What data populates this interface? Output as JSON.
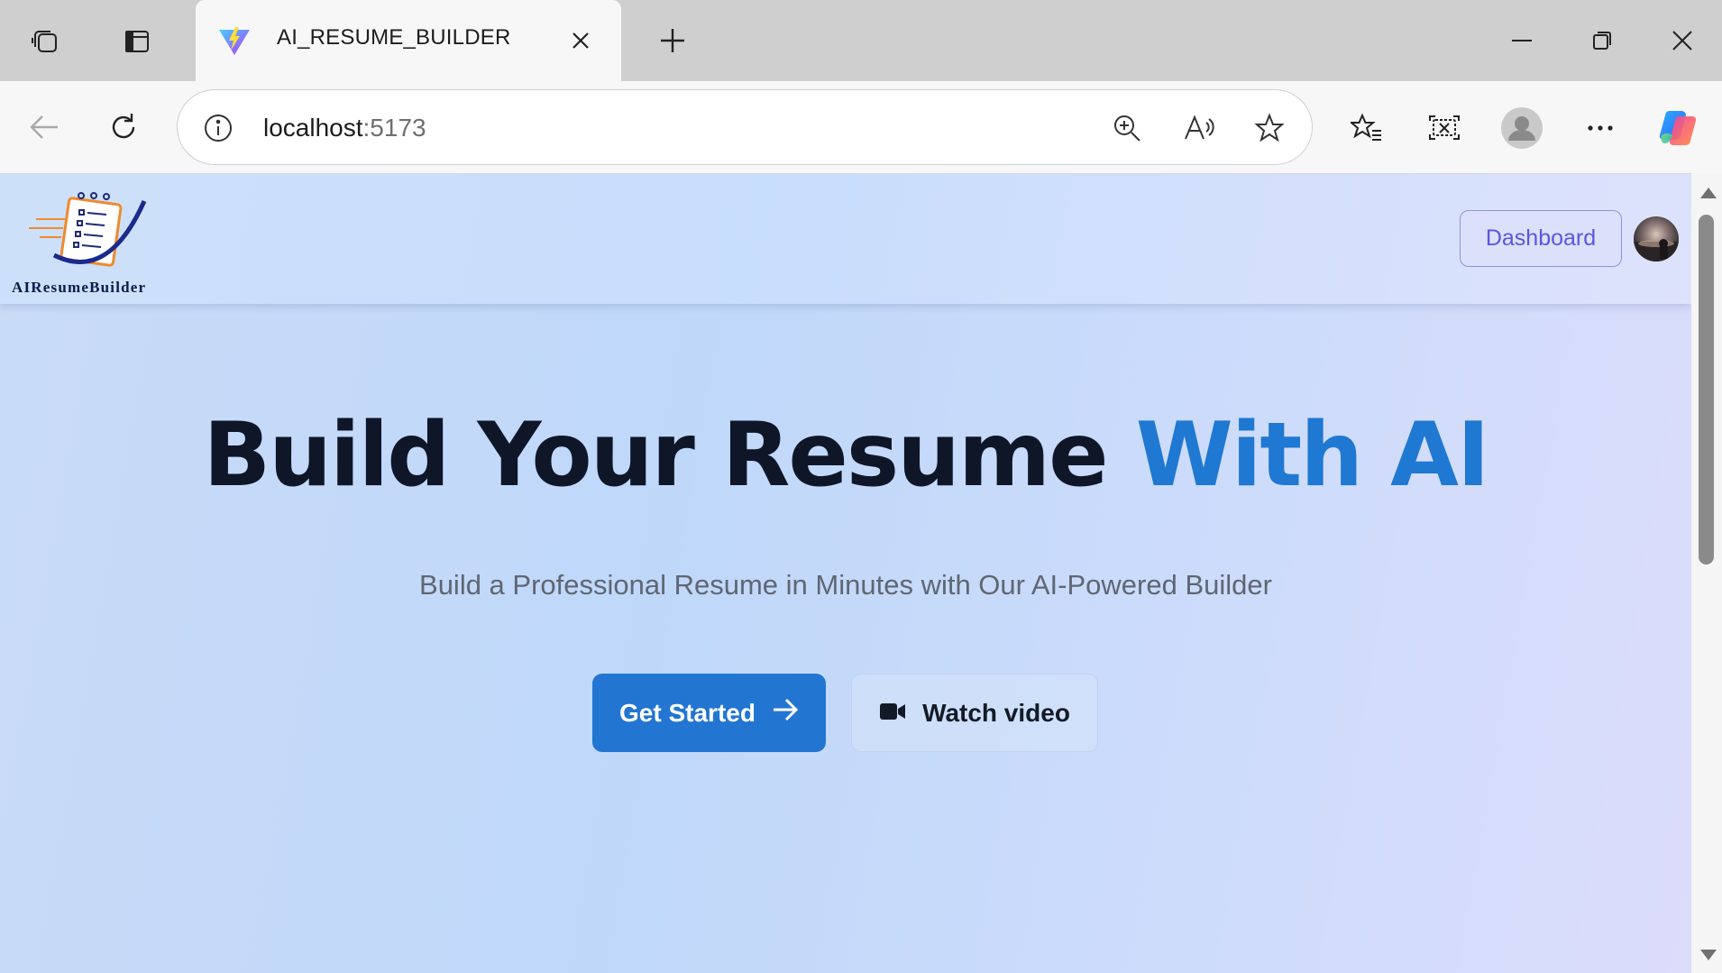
{
  "browser": {
    "tab": {
      "title": "AI_RESUME_BUILDER"
    },
    "address": {
      "host": "localhost",
      "port": ":5173"
    }
  },
  "site": {
    "logo_text": "AIResumeBuilder",
    "header": {
      "dashboard_label": "Dashboard"
    },
    "hero": {
      "title_main": "Build Your Resume",
      "title_accent": "With AI",
      "subtitle": "Build a Professional Resume in Minutes with Our AI-Powered Builder",
      "primary_cta": "Get Started",
      "secondary_cta": "Watch video"
    }
  },
  "colors": {
    "accent": "#1f78d1",
    "primary_button": "#2276d2",
    "dashboard_text": "#5a57e0",
    "title_dark": "#0e1628"
  }
}
